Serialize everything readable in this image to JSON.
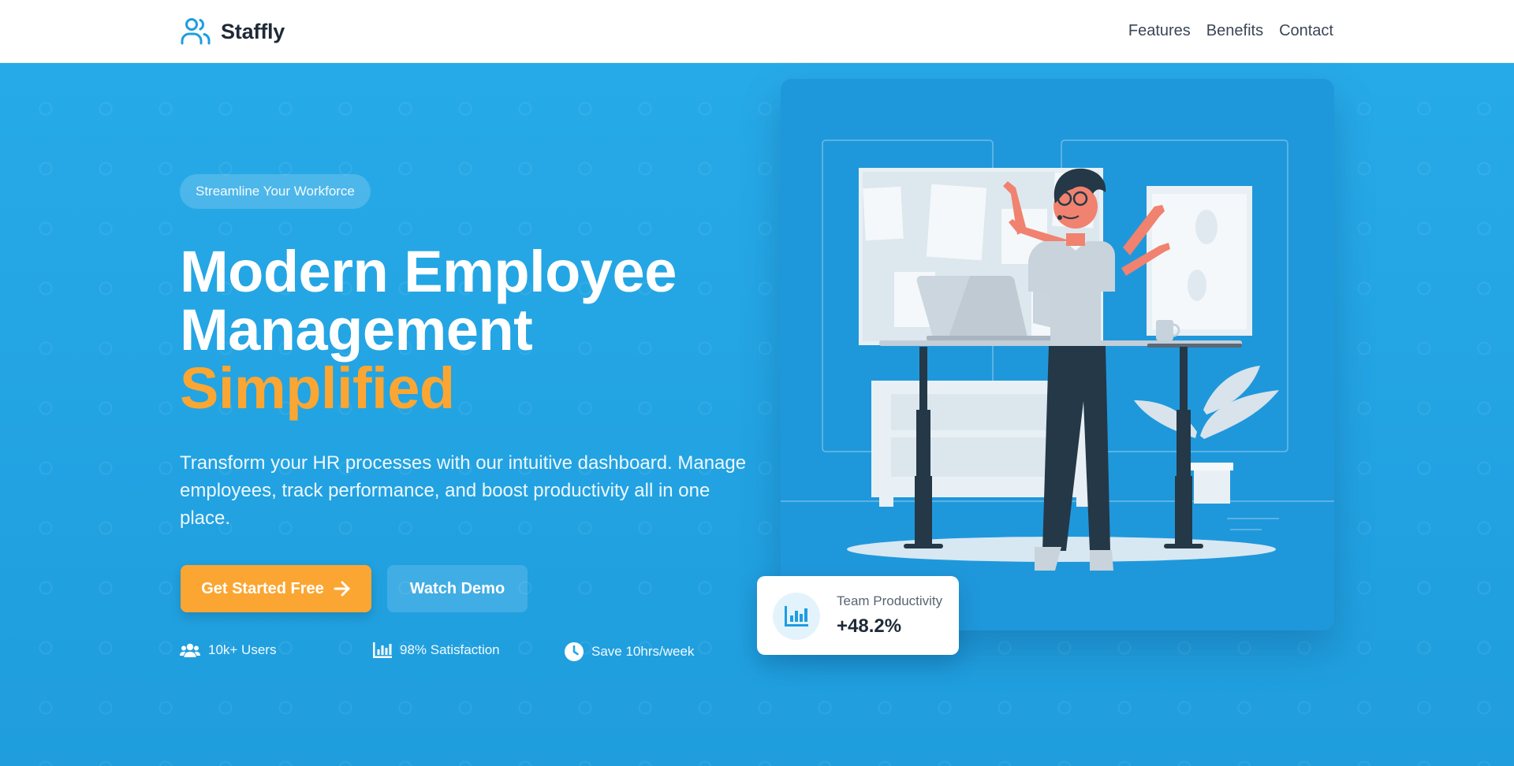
{
  "brand": {
    "name": "Staffly",
    "icon": "users-icon"
  },
  "nav": {
    "links": [
      "Features",
      "Benefits",
      "Contact"
    ]
  },
  "hero": {
    "pill": "Streamline Your Workforce",
    "headline": {
      "line1": "Modern Employee",
      "line2": "Management",
      "line3": "Simplified"
    },
    "subtext": "Transform your HR processes with our intuitive dashboard. Manage employees, track performance, and boost productivity all in one place.",
    "cta_primary": "Get Started Free",
    "cta_primary_icon": "arrow-right-icon",
    "cta_secondary": "Watch Demo",
    "stats": [
      {
        "icon": "users-icon",
        "label": "10k+ Users"
      },
      {
        "icon": "bar-chart-icon",
        "label": "98% Satisfaction"
      },
      {
        "icon": "clock-icon",
        "label": "Save 10hrs/week"
      }
    ]
  },
  "metric_card": {
    "label": "Team Productivity",
    "value": "+48.2%",
    "icon": "bar-chart-icon"
  },
  "colors": {
    "primary": "#26a6e6",
    "accent": "#fba632",
    "brand_blue": "#1e9de0",
    "dark_text": "#1f2a37"
  }
}
